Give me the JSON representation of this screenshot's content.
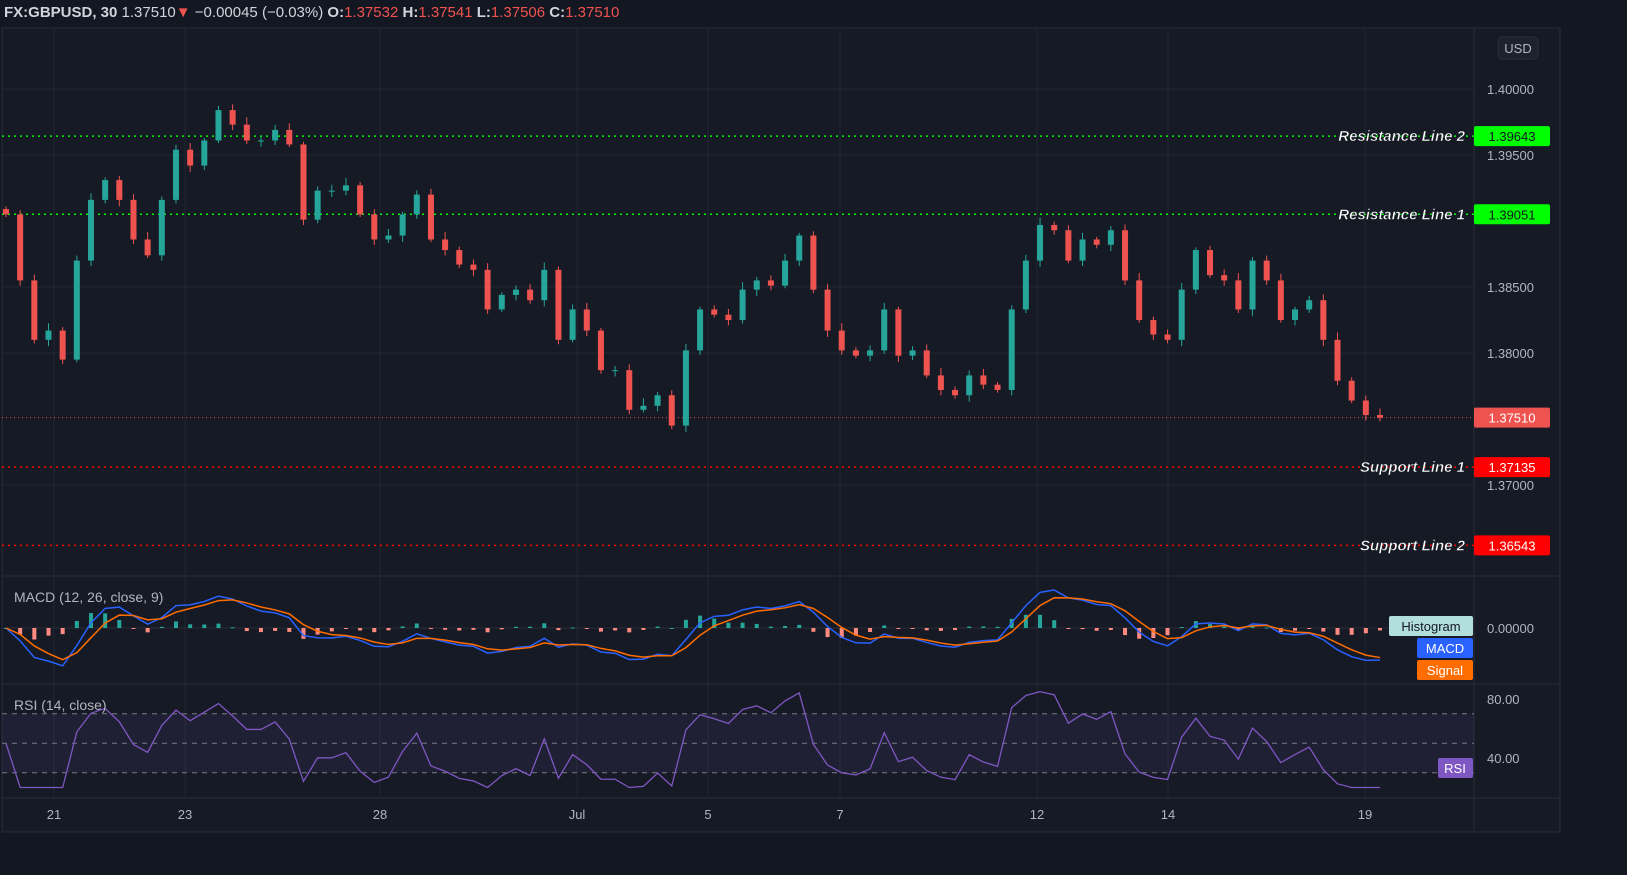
{
  "header": {
    "symbol": "FX:GBPUSD, 30",
    "last": "1.37510",
    "change": "−0.00045 (−0.03%)",
    "o_label": "O:",
    "o": "1.37532",
    "h_label": "H:",
    "h": "1.37541",
    "l_label": "L:",
    "l": "1.37506",
    "c_label": "C:",
    "c": "1.37510",
    "direction_icon": "triangle-down-icon"
  },
  "currency_button": "USD",
  "colors": {
    "background": "#161a25",
    "up": "#26a69a",
    "down": "#ef5350",
    "resistance": "#00ff00",
    "support": "#ff0000",
    "macd": "#2962ff",
    "signal": "#ff6d00",
    "histogram": "#b2dfdb",
    "rsi": "#7e57c2"
  },
  "chart_data": [
    {
      "type": "candlestick",
      "title": "FX:GBPUSD, 30",
      "price_ticks": [
        "1.40000",
        "1.39500",
        "1.38500",
        "1.38000",
        "1.37000"
      ],
      "price_tick_values": [
        1.4,
        1.395,
        1.385,
        1.38,
        1.37
      ],
      "ylim": [
        1.3615,
        1.4068
      ],
      "x_tick_labels": [
        "21",
        "23",
        "28",
        "Jul",
        "5",
        "7",
        "12",
        "14",
        "19"
      ],
      "close": [
        1.3905,
        1.3855,
        1.381,
        1.3817,
        1.3795,
        1.387,
        1.3916,
        1.3931,
        1.3916,
        1.3886,
        1.3874,
        1.3916,
        1.3954,
        1.3942,
        1.3961,
        1.3984,
        1.3973,
        1.3961,
        1.3961,
        1.3969,
        1.3958,
        1.3901,
        1.3923,
        1.3923,
        1.3927,
        1.3905,
        1.3886,
        1.3889,
        1.3905,
        1.392,
        1.3886,
        1.3878,
        1.3867,
        1.3863,
        1.3833,
        1.3844,
        1.3848,
        1.384,
        1.3863,
        1.381,
        1.3833,
        1.3817,
        1.3787,
        1.3787,
        1.3757,
        1.376,
        1.3768,
        1.3745,
        1.3802,
        1.3833,
        1.3829,
        1.3825,
        1.3848,
        1.3855,
        1.3851,
        1.387,
        1.3889,
        1.3848,
        1.3817,
        1.3802,
        1.3798,
        1.3802,
        1.3833,
        1.3798,
        1.3802,
        1.3783,
        1.3772,
        1.3768,
        1.3783,
        1.3776,
        1.3772,
        1.3833,
        1.387,
        1.3897,
        1.3893,
        1.387,
        1.3886,
        1.3882,
        1.3893,
        1.3855,
        1.3825,
        1.3814,
        1.381,
        1.3848,
        1.3878,
        1.3859,
        1.3855,
        1.3833,
        1.387,
        1.3855,
        1.3825,
        1.3833,
        1.384,
        1.381,
        1.3779,
        1.3764,
        1.3753,
        1.3751
      ],
      "levels": [
        {
          "label": "Resistance Line 2",
          "value": 1.39643,
          "value_text": "1.39643",
          "kind": "resistance"
        },
        {
          "label": "Resistance Line 1",
          "value": 1.39051,
          "value_text": "1.39051",
          "kind": "resistance"
        },
        {
          "label": "Support Line 1",
          "value": 1.37135,
          "value_text": "1.37135",
          "kind": "support"
        },
        {
          "label": "Support Line 2",
          "value": 1.36543,
          "value_text": "1.36543",
          "kind": "support"
        }
      ],
      "current_price": {
        "value": 1.3751,
        "value_text": "1.37510"
      }
    },
    {
      "type": "line",
      "title": "MACD (12, 26, close, 9)",
      "params": {
        "fast": 12,
        "slow": 26,
        "signal": 9
      },
      "zero_tick": "0.00000",
      "legend": [
        "Histogram",
        "MACD",
        "Signal"
      ]
    },
    {
      "type": "line",
      "title": "RSI (14, close)",
      "params": {
        "length": 14
      },
      "ticks": [
        "80.00",
        "40.00"
      ],
      "bands": [
        70,
        50,
        30
      ],
      "legend": [
        "RSI"
      ]
    }
  ]
}
